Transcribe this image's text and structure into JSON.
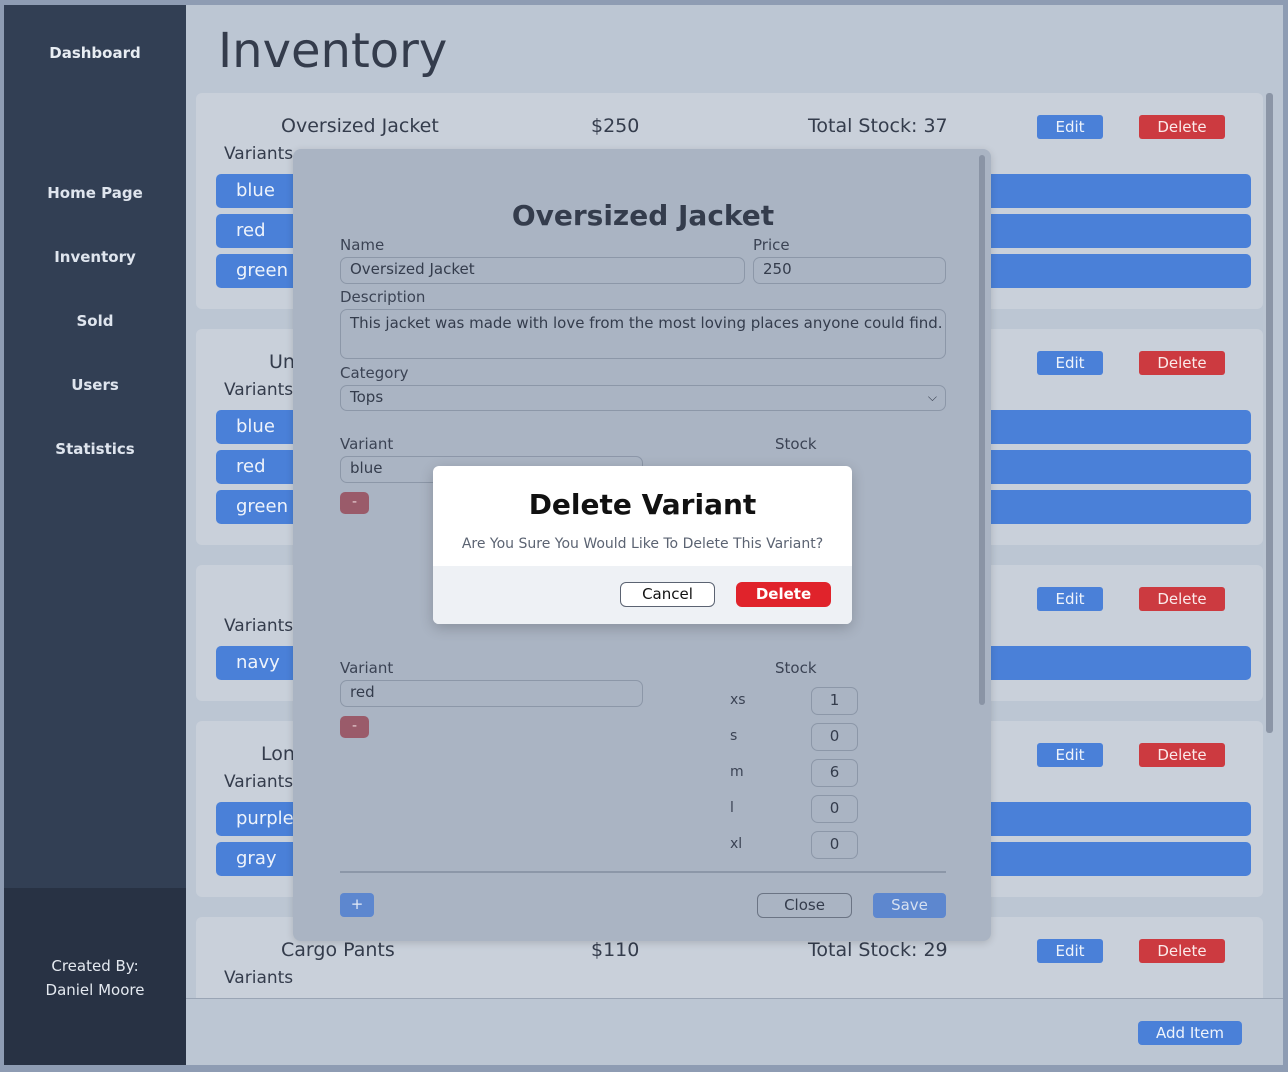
{
  "sidebar": {
    "brand": "Dashboard",
    "items": [
      {
        "label": "Home Page"
      },
      {
        "label": "Inventory"
      },
      {
        "label": "Sold"
      },
      {
        "label": "Users"
      },
      {
        "label": "Statistics"
      }
    ],
    "footer_line1": "Created By:",
    "footer_line2": "Daniel Moore"
  },
  "main": {
    "title": "Inventory",
    "edit_label": "Edit",
    "delete_label": "Delete",
    "variants_label": "Variants",
    "add_item_label": "Add Item",
    "cards": [
      {
        "name": "Oversized Jacket",
        "price": "$250",
        "stock": "Total Stock: 37",
        "variants": [
          "blue",
          "red",
          "green"
        ]
      },
      {
        "name": "Un",
        "price": "",
        "stock": "",
        "variants": [
          "blue",
          "red",
          "green"
        ]
      },
      {
        "name": "",
        "price": "",
        "stock": "",
        "variants": [
          "navy"
        ]
      },
      {
        "name": "Lon",
        "price": "",
        "stock": "",
        "variants": [
          "purple",
          "gray"
        ]
      },
      {
        "name": "Cargo Pants",
        "price": "$110",
        "stock": "Total Stock: 29",
        "variants": []
      }
    ]
  },
  "edit_modal": {
    "title": "Oversized Jacket",
    "name_label": "Name",
    "name_value": "Oversized Jacket",
    "price_label": "Price",
    "price_value": "250",
    "description_label": "Description",
    "description_value": "This jacket was made with love from the most loving places anyone could find.",
    "category_label": "Category",
    "category_value": "Tops",
    "variant_label": "Variant",
    "stock_label": "Stock",
    "minus_label": "-",
    "plus_label": "+",
    "close_label": "Close",
    "save_label": "Save",
    "variant1": {
      "value": "blue"
    },
    "variant2": {
      "value": "red",
      "sizes": [
        {
          "size": "xs",
          "qty": "1"
        },
        {
          "size": "s",
          "qty": "0"
        },
        {
          "size": "m",
          "qty": "6"
        },
        {
          "size": "l",
          "qty": "0"
        },
        {
          "size": "xl",
          "qty": "0"
        }
      ]
    }
  },
  "confirm_dialog": {
    "title": "Delete Variant",
    "message": "Are You Sure You Would Like To Delete This Variant?",
    "cancel_label": "Cancel",
    "delete_label": "Delete"
  },
  "colors": {
    "accent": "#4a80d8",
    "danger": "#cc3a40",
    "sidebar": "#323f54"
  }
}
